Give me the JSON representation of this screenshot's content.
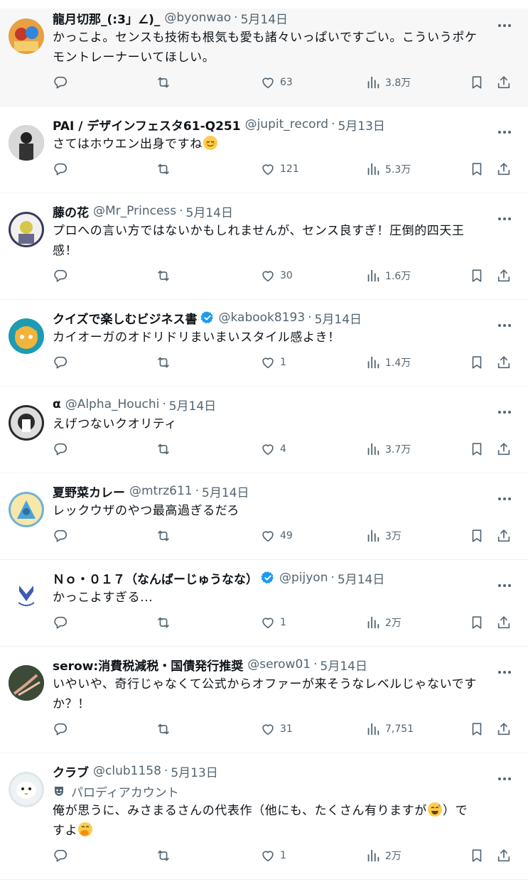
{
  "tweets": [
    {
      "name": "龍月切那_(:3」∠)_",
      "verified": false,
      "handle": "@byonwao",
      "sep": "·",
      "date": "5月14日",
      "parody": "",
      "text": [
        "かっこよ。センスも技術も根気も愛も諸々いっぱいですごい。こういうポケ",
        "モントレーナーいてほしい。"
      ],
      "likes": "63",
      "views": "3.8万",
      "highlighted": true,
      "avatar_color": "#e8a040"
    },
    {
      "name": "PAI / デザインフェスタ61-Q251",
      "verified": false,
      "handle": "@jupit_record",
      "sep": "·",
      "date": "5月13日",
      "parody": "",
      "text": [
        "さてはホウエン出身ですね"
      ],
      "emoji": "relieved-face",
      "likes": "121",
      "views": "5.3万",
      "highlighted": false,
      "avatar_color": "#777777"
    },
    {
      "name": "藤の花",
      "verified": false,
      "handle": "@Mr_Princess",
      "sep": "·",
      "date": "5月14日",
      "parody": "",
      "text": [
        "プロへの言い方ではないかもしれませんが、センス良すぎ！圧倒的四天王",
        "感！"
      ],
      "likes": "30",
      "views": "1.6万",
      "highlighted": false,
      "avatar_color": "#3a3a5a"
    },
    {
      "name": "クイズで楽しむビジネス書",
      "verified": true,
      "handle": "@kabook8193",
      "sep": "·",
      "date": "5月14日",
      "parody": "",
      "text": [
        "カイオーガのオドリドリまいまいスタイル感よき！"
      ],
      "likes": "1",
      "views": "1.4万",
      "highlighted": false,
      "avatar_color": "#1d9bb3"
    },
    {
      "name": "α",
      "verified": false,
      "handle": "@Alpha_Houchi",
      "sep": "·",
      "date": "5月14日",
      "parody": "",
      "text": [
        "えげつないクオリティ"
      ],
      "likes": "4",
      "views": "3.7万",
      "highlighted": false,
      "avatar_color": "#2a2a2a"
    },
    {
      "name": "夏野菜カレー",
      "verified": false,
      "handle": "@mtrz611",
      "sep": "·",
      "date": "5月14日",
      "parody": "",
      "text": [
        "レックウザのやつ最高過ぎるだろ"
      ],
      "likes": "49",
      "views": "3万",
      "highlighted": false,
      "avatar_color": "#6cb2d6"
    },
    {
      "name": "Ｎｏ・０１７（なんばーじゅうなな）",
      "verified": true,
      "handle": "@pijyon",
      "sep": "·",
      "date": "5月14日",
      "parody": "",
      "text": [
        "かっこよすぎる..."
      ],
      "likes": "1",
      "views": "2万",
      "highlighted": false,
      "avatar_color": "#ffffff"
    },
    {
      "name": "serow:消費税減税・国債発行推奨",
      "verified": false,
      "handle": "@serow01",
      "sep": "·",
      "date": "5月14日",
      "parody": "",
      "text": [
        "いやいや、奇行じゃなくて公式からオファーが来そうなレベルじゃないです",
        "か？！"
      ],
      "likes": "31",
      "views": "7,751",
      "highlighted": false,
      "avatar_color": "#3d4a38"
    },
    {
      "name": "クラブ",
      "verified": false,
      "handle": "@club1158",
      "sep": "·",
      "date": "5月13日",
      "parody": "パロディアカウント",
      "text": [
        "俺が思うに、みさまるさんの代表作（他にも、たくさん有りますが",
        "）で",
        "すよ"
      ],
      "likes": "1",
      "views": "2万",
      "highlighted": false,
      "avatar_color": "#dfe6ea"
    }
  ],
  "icons": {
    "reply": "reply-icon",
    "retweet": "retweet-icon",
    "like": "heart-icon",
    "views": "views-icon",
    "bookmark": "bookmark-icon",
    "share": "share-icon",
    "more": "more-icon",
    "verified": "verified-badge-icon",
    "parody": "parody-mask-icon"
  },
  "colors": {
    "text": "#0f1419",
    "secondary": "#536471",
    "verified": "#1d9bf0",
    "divider": "#eff3f4"
  }
}
